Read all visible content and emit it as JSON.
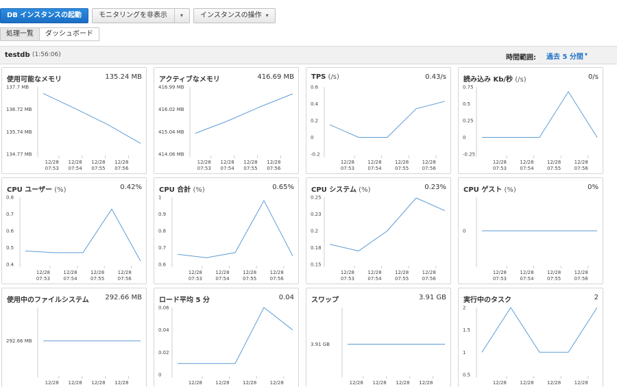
{
  "toolbar": {
    "launch_label": "DB インスタンスの起動",
    "monitoring_label": "モニタリングを非表示",
    "actions_label": "インスタンスの操作"
  },
  "tabs": [
    {
      "label": "処理一覧"
    },
    {
      "label": "ダッシュボード"
    }
  ],
  "instance": {
    "name": "testdb",
    "uptime": "(1:56:06)"
  },
  "time_range": {
    "label": "時間範囲:",
    "value": "過去 5 分間"
  },
  "colors": {
    "line": "#5b9bd5",
    "axis": "#cccccc",
    "primary": "#1a6fc4",
    "link": "#2174c6"
  },
  "x_labels": [
    {
      "top": "12/28",
      "bottom": "07:53"
    },
    {
      "top": "12/28",
      "bottom": "07:54"
    },
    {
      "top": "12/28",
      "bottom": "07:55"
    },
    {
      "top": "12/28",
      "bottom": "07:56"
    }
  ],
  "panels": [
    {
      "title": "使用可能なメモリ",
      "unit": "",
      "value": "135.24 MB",
      "chart_data": {
        "type": "line",
        "yticks": [
          "137.7 MB",
          "136.72 MB",
          "135.74 MB",
          "134.77 MB"
        ],
        "ylim": [
          134.77,
          137.7
        ],
        "series": [
          {
            "values": [
              137.42,
              136.75,
              136.05,
              135.24
            ]
          }
        ]
      }
    },
    {
      "title": "アクティブなメモリ",
      "unit": "",
      "value": "416.69 MB",
      "chart_data": {
        "type": "line",
        "yticks": [
          "416.99 MB",
          "416.02 MB",
          "415.04 MB",
          "414.06 MB"
        ],
        "ylim": [
          414.06,
          416.99
        ],
        "series": [
          {
            "values": [
              414.97,
              415.51,
              416.13,
              416.69
            ]
          }
        ]
      }
    },
    {
      "title": "TPS",
      "unit": "(/s)",
      "value": "0.43/s",
      "chart_data": {
        "type": "line",
        "yticks": [
          "0.6",
          "0.4",
          "0.2",
          "0",
          "-0.2"
        ],
        "ylim": [
          -0.2,
          0.6
        ],
        "series": [
          {
            "values": [
              0.15,
              0,
              0,
              0.34,
              0.43
            ]
          }
        ]
      }
    },
    {
      "title": "読み込み Kb/秒",
      "unit": "(/s)",
      "value": "0/s",
      "chart_data": {
        "type": "line",
        "yticks": [
          "0.75",
          "0.5",
          "0.25",
          "0",
          "-0.25"
        ],
        "ylim": [
          -0.25,
          0.75
        ],
        "series": [
          {
            "values": [
              0,
              0,
              0,
              0.68,
              0
            ]
          }
        ]
      }
    },
    {
      "title": "CPU ユーザー",
      "unit": "(%)",
      "value": "0.42%",
      "chart_data": {
        "type": "line",
        "yticks": [
          "0.8",
          "0.7",
          "0.6",
          "0.5",
          "0.4"
        ],
        "ylim": [
          0.4,
          0.8
        ],
        "series": [
          {
            "values": [
              0.48,
              0.47,
              0.47,
              0.73,
              0.42
            ]
          }
        ]
      }
    },
    {
      "title": "CPU 合計",
      "unit": "(%)",
      "value": "0.65%",
      "chart_data": {
        "type": "line",
        "yticks": [
          "1",
          "0.9",
          "0.8",
          "0.7",
          "0.6"
        ],
        "ylim": [
          0.6,
          1
        ],
        "series": [
          {
            "values": [
              0.66,
              0.64,
              0.67,
              0.98,
              0.65
            ]
          }
        ]
      }
    },
    {
      "title": "CPU システム",
      "unit": "(%)",
      "value": "0.23%",
      "chart_data": {
        "type": "line",
        "yticks": [
          "0.25",
          "0.23",
          "0.2",
          "0.18",
          "0.15"
        ],
        "ylim": [
          0.15,
          0.25
        ],
        "series": [
          {
            "values": [
              0.18,
              0.17,
              0.2,
              0.249,
              0.23
            ]
          }
        ]
      }
    },
    {
      "title": "CPU ゲスト",
      "unit": "(%)",
      "value": "0%",
      "chart_data": {
        "type": "line",
        "yticks": [
          "0"
        ],
        "ylim": [
          -1,
          1
        ],
        "series": [
          {
            "values": [
              0,
              0,
              0,
              0,
              0
            ]
          }
        ]
      }
    },
    {
      "title": "使用中のファイルシステム",
      "unit": "",
      "value": "292.66 MB",
      "chart_data": {
        "type": "line",
        "yticks": [
          "292.66 MB"
        ],
        "ylim": [
          291,
          294.3
        ],
        "series": [
          {
            "values": [
              292.66,
              292.66,
              292.66,
              292.66,
              292.66
            ]
          }
        ]
      }
    },
    {
      "title": "ロード平均 5 分",
      "unit": "",
      "value": "0.04",
      "chart_data": {
        "type": "line",
        "yticks": [
          "0.06",
          "0.04",
          "0.02",
          "0"
        ],
        "ylim": [
          0,
          0.06
        ],
        "series": [
          {
            "values": [
              0.01,
              0.01,
              0.01,
              0.06,
              0.04
            ]
          }
        ]
      }
    },
    {
      "title": "スワップ",
      "unit": "",
      "value": "3.91 GB",
      "chart_data": {
        "type": "line",
        "yticks": [
          "3.91 GB"
        ],
        "ylim": [
          3.86,
          3.97
        ],
        "series": [
          {
            "values": [
              3.91,
              3.91,
              3.91,
              3.91,
              3.91
            ]
          }
        ]
      }
    },
    {
      "title": "実行中のタスク",
      "unit": "",
      "value": "2",
      "chart_data": {
        "type": "line",
        "yticks": [
          "2",
          "1.5",
          "1",
          "0.5"
        ],
        "ylim": [
          0.5,
          2
        ],
        "series": [
          {
            "values": [
              1,
              2,
              1,
              1,
              2
            ]
          }
        ]
      }
    }
  ]
}
